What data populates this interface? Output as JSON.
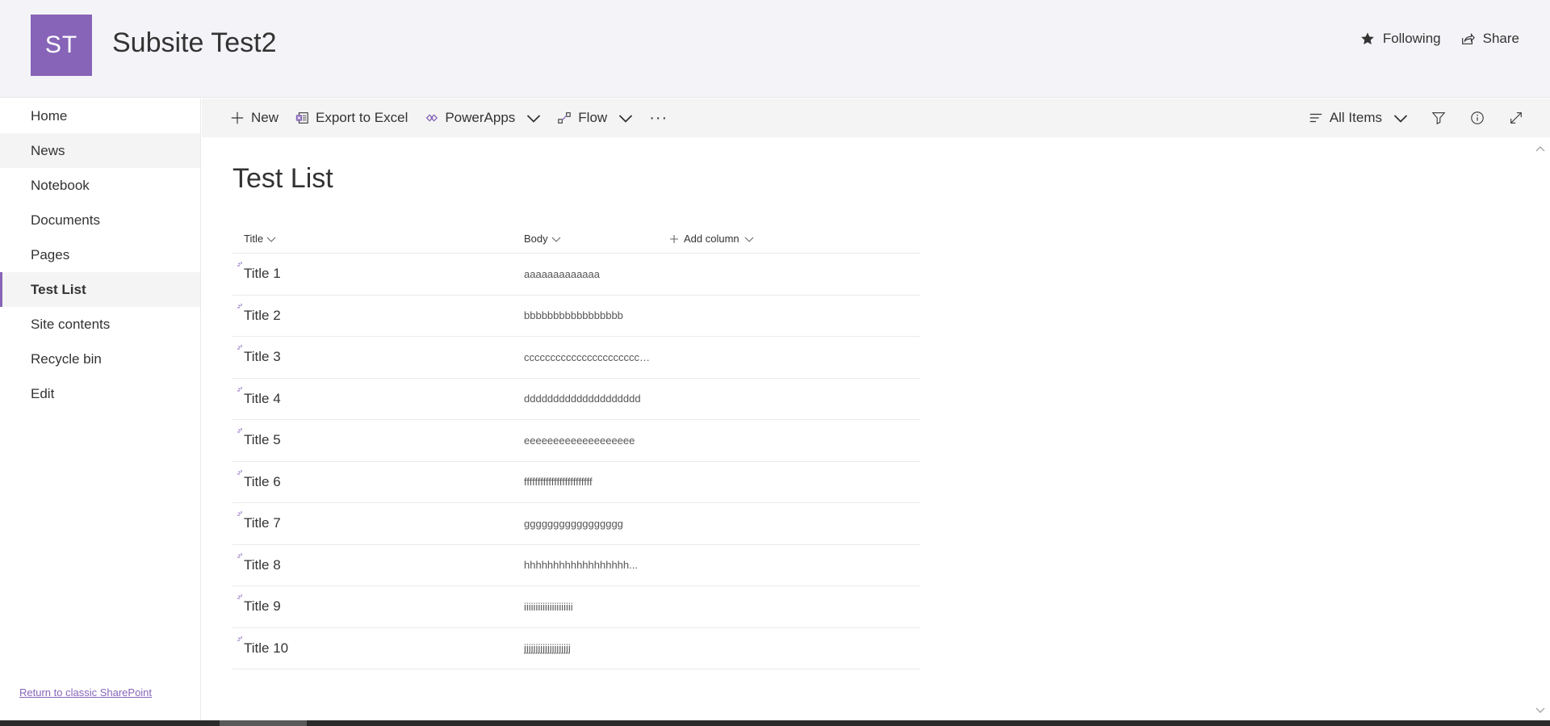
{
  "header": {
    "logo_text": "ST",
    "site_title": "Subsite Test2",
    "following_label": "Following",
    "share_label": "Share",
    "accent": "#8764b8"
  },
  "nav": {
    "items": [
      {
        "label": "Home"
      },
      {
        "label": "News"
      },
      {
        "label": "Notebook"
      },
      {
        "label": "Documents"
      },
      {
        "label": "Pages"
      },
      {
        "label": "Test List"
      },
      {
        "label": "Site contents"
      },
      {
        "label": "Recycle bin"
      },
      {
        "label": "Edit"
      }
    ],
    "active": "Test List",
    "return_link": "Return to classic SharePoint"
  },
  "commandbar": {
    "new_label": "New",
    "export_label": "Export to Excel",
    "powerapps_label": "PowerApps",
    "flow_label": "Flow",
    "more_label": "···",
    "view_label": "All Items"
  },
  "list": {
    "title": "Test List",
    "columns": {
      "title": "Title",
      "body": "Body",
      "add": "Add column"
    },
    "rows": [
      {
        "title": "Title 1",
        "body": "aaaaaaaaaaaaa"
      },
      {
        "title": "Title 2",
        "body": "bbbbbbbbbbbbbbbbb"
      },
      {
        "title": "Title 3",
        "body": "ccccccccccccccccccccccc..."
      },
      {
        "title": "Title 4",
        "body": "dddddddddddddddddddd"
      },
      {
        "title": "Title 5",
        "body": "eeeeeeeeeeeeeeeeeee"
      },
      {
        "title": "Title 6",
        "body": "fffffffffffffffffffffffff"
      },
      {
        "title": "Title 7",
        "body": "ggggggggggggggggg"
      },
      {
        "title": "Title 8",
        "body": "hhhhhhhhhhhhhhhhhh..."
      },
      {
        "title": "Title 9",
        "body": "iiiiiiiiiiiiiiiiiiiii"
      },
      {
        "title": "Title 10",
        "body": "jjjjjjjjjjjjjjjjjjjj"
      }
    ]
  }
}
